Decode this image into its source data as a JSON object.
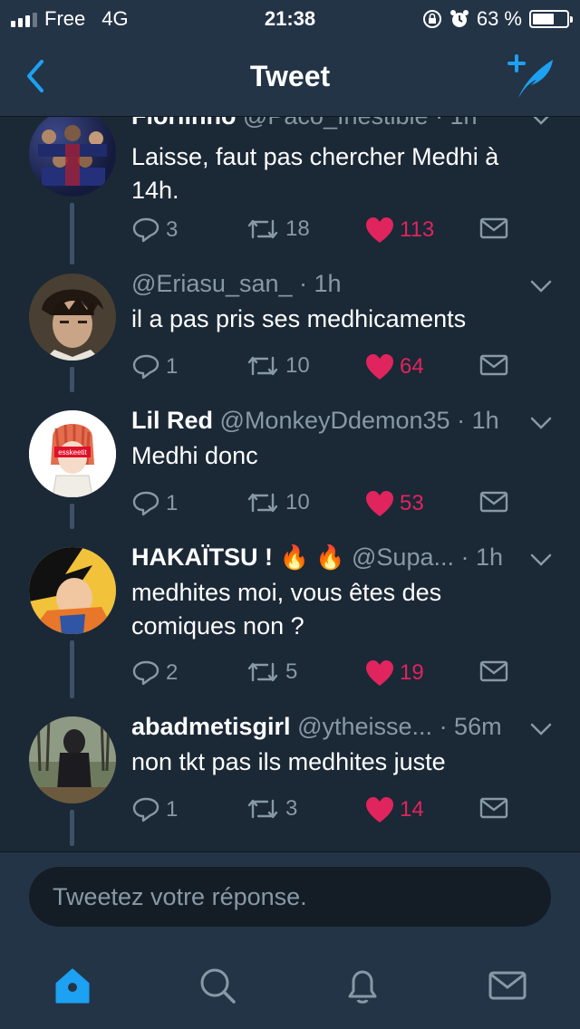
{
  "status_bar": {
    "carrier": "Free",
    "network": "4G",
    "time": "21:38",
    "battery": "63 %",
    "battery_level": 0.63
  },
  "nav": {
    "title": "Tweet",
    "back_icon": "chevron-left-icon",
    "compose_icon": "compose-tweet-icon"
  },
  "colors": {
    "background": "#1b2836",
    "bar": "#243447",
    "accent": "#1da1f2",
    "like": "#e0245e",
    "secondary_text": "#8899a6"
  },
  "tweets": [
    {
      "name": "Floriinho",
      "handle": "@Paco_Inestible",
      "time": "· 1h",
      "text": "Laisse, faut pas chercher Medhi à 14h.",
      "replies": "3",
      "retweets": "18",
      "likes": "113",
      "liked": true
    },
    {
      "name": "",
      "handle": "@Eriasu_san_",
      "time": "· 1h",
      "text": "il a pas pris ses medhicaments",
      "replies": "1",
      "retweets": "10",
      "likes": "64",
      "liked": true
    },
    {
      "name": "Lil Red",
      "handle": "@MonkeyDdemon35",
      "time": "· 1h",
      "text": "Medhi donc",
      "replies": "1",
      "retweets": "10",
      "likes": "53",
      "liked": true,
      "avatar_label": "esskeetit"
    },
    {
      "name": "HAKAÏTSU !",
      "name_emoji": "🔥 🔥",
      "handle": "@Supa...",
      "time": "· 1h",
      "text": "medhites moi, vous êtes des comiques non ?",
      "replies": "2",
      "retweets": "5",
      "likes": "19",
      "liked": true
    },
    {
      "name": "abadmetisgirl",
      "handle": "@ytheisse...",
      "time": "· 56m",
      "text": "non tkt pas ils medhites juste",
      "replies": "1",
      "retweets": "3",
      "likes": "14",
      "liked": true
    }
  ],
  "reply": {
    "placeholder": "Tweetez votre réponse."
  },
  "tabbar": {
    "items": [
      "home-icon",
      "search-icon",
      "notifications-bell-icon",
      "messages-envelope-icon"
    ],
    "active": "home-icon"
  }
}
